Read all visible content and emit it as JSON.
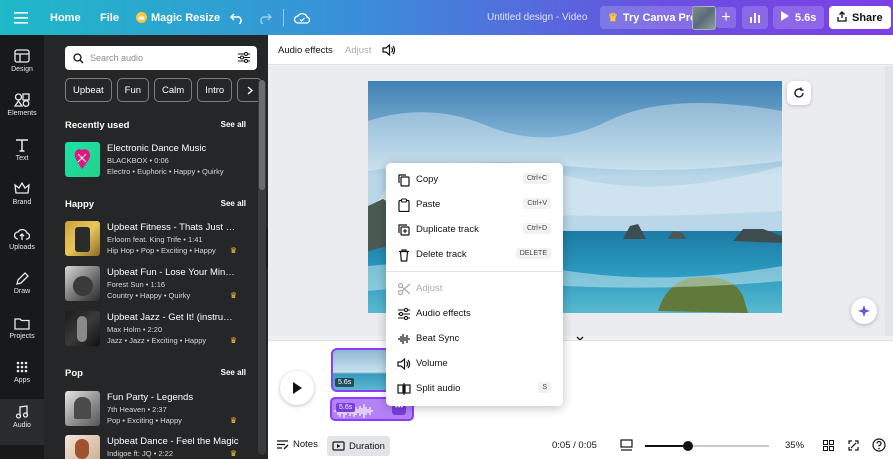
{
  "topbar": {
    "home": "Home",
    "file": "File",
    "magic_resize": "Magic Resize",
    "doc_title": "Untitled design - Video",
    "try_pro": "Try Canva Pro",
    "duration": "5.6s",
    "share": "Share"
  },
  "rail": [
    {
      "label": "Design",
      "icon": "layout-icon"
    },
    {
      "label": "Elements",
      "icon": "shapes-icon"
    },
    {
      "label": "Text",
      "icon": "text-icon"
    },
    {
      "label": "Brand",
      "icon": "crown-icon"
    },
    {
      "label": "Uploads",
      "icon": "upload-icon"
    },
    {
      "label": "Draw",
      "icon": "pen-icon"
    },
    {
      "label": "Projects",
      "icon": "folder-icon"
    },
    {
      "label": "Apps",
      "icon": "grid-icon"
    },
    {
      "label": "Audio",
      "icon": "music-note-icon"
    }
  ],
  "panel": {
    "search_placeholder": "Search audio",
    "chips": [
      "Upbeat",
      "Fun",
      "Calm",
      "Intro"
    ],
    "sections": {
      "recent": {
        "title": "Recently used",
        "see_all": "See all"
      },
      "happy": {
        "title": "Happy",
        "see_all": "See all"
      },
      "pop": {
        "title": "Pop",
        "see_all": "See all"
      }
    },
    "tracks": [
      {
        "title": "Electronic Dance Music",
        "artist": "BLACKBOX • 0:06",
        "tags": "Electro • Euphoric • Happy • Quirky",
        "premium": false
      },
      {
        "title": "Upbeat Fitness - Thats Just M...",
        "artist": "Erloom feat. King Trife • 1:41",
        "tags": "Hip Hop • Pop • Exciting • Happy",
        "premium": true
      },
      {
        "title": "Upbeat Fun - Lose Your Mind R...",
        "artist": "Forest Sun • 1:16",
        "tags": "Country • Happy • Quirky",
        "premium": true
      },
      {
        "title": "Upbeat Jazz - Get It! (instrume...",
        "artist": "Max Holm • 2:20",
        "tags": "Jazz • Jazz • Exciting • Happy",
        "premium": true
      },
      {
        "title": "Fun Party - Legends",
        "artist": "7th Heaven • 2:37",
        "tags": "Pop • Exciting • Happy",
        "premium": true
      },
      {
        "title": "Upbeat Dance - Feel the Magic",
        "artist": "Indigoe ft: JQ • 2:22",
        "tags": "",
        "premium": true
      }
    ]
  },
  "context_bar": {
    "audio_effects": "Audio effects",
    "adjust": "Adjust"
  },
  "menu": {
    "items": [
      {
        "label": "Copy",
        "shortcut": "Ctrl+C",
        "icon": "copy-icon",
        "disabled": false
      },
      {
        "label": "Paste",
        "shortcut": "Ctrl+V",
        "icon": "paste-icon",
        "disabled": false
      },
      {
        "label": "Duplicate track",
        "shortcut": "Ctrl+D",
        "icon": "duplicate-icon",
        "disabled": false
      },
      {
        "label": "Delete track",
        "shortcut": "DELETE",
        "icon": "trash-icon",
        "disabled": false
      },
      {
        "label": "Adjust",
        "shortcut": "",
        "icon": "adjust-icon",
        "disabled": true
      },
      {
        "label": "Audio effects",
        "shortcut": "",
        "icon": "sliders-icon",
        "disabled": false
      },
      {
        "label": "Beat Sync",
        "shortcut": "",
        "icon": "beat-sync-icon",
        "disabled": false
      },
      {
        "label": "Volume",
        "shortcut": "",
        "icon": "volume-icon",
        "disabled": false
      },
      {
        "label": "Split audio",
        "shortcut": "S",
        "icon": "split-icon",
        "disabled": false
      }
    ]
  },
  "timeline": {
    "video_clip_duration": "5.6s",
    "audio_clip_duration": "5.6s"
  },
  "bottombar": {
    "notes": "Notes",
    "duration": "Duration",
    "time": "0:05 / 0:05",
    "zoom": "35%",
    "zoom_level": 0.35
  }
}
